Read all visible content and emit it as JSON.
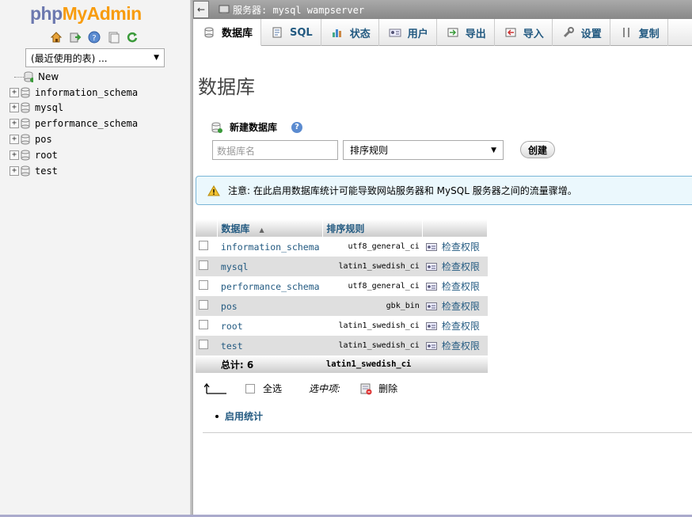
{
  "logo": {
    "php": "php",
    "my": "My",
    "admin": "Admin"
  },
  "nav": {
    "recent_select": "(最近使用的表) ...",
    "tree": [
      {
        "label": "New",
        "expandable": false
      },
      {
        "label": "information_schema",
        "expandable": true
      },
      {
        "label": "mysql",
        "expandable": true
      },
      {
        "label": "performance_schema",
        "expandable": true
      },
      {
        "label": "pos",
        "expandable": true
      },
      {
        "label": "root",
        "expandable": true
      },
      {
        "label": "test",
        "expandable": true
      }
    ],
    "icons": [
      "home-icon",
      "logout-icon",
      "help-icon",
      "docs-icon",
      "reload-icon"
    ]
  },
  "topbar": {
    "back": "←",
    "server": "服务器: mysql wampserver"
  },
  "tabs": [
    {
      "label": "数据库",
      "icon": "database-icon",
      "active": true
    },
    {
      "label": "SQL",
      "icon": "sql-icon",
      "active": false
    },
    {
      "label": "状态",
      "icon": "status-icon",
      "active": false
    },
    {
      "label": "用户",
      "icon": "users-icon",
      "active": false
    },
    {
      "label": "导出",
      "icon": "export-icon",
      "active": false
    },
    {
      "label": "导入",
      "icon": "import-icon",
      "active": false
    },
    {
      "label": "设置",
      "icon": "settings-icon",
      "active": false
    },
    {
      "label": "复制",
      "icon": "replication-icon",
      "active": false
    }
  ],
  "page": {
    "title": "数据库",
    "create_label": "新建数据库",
    "dbname_placeholder": "数据库名",
    "collation_select": "排序规则",
    "create_button": "创建",
    "notice": "注意: 在此启用数据库统计可能导致网站服务器和 MySQL 服务器之间的流量骤增。"
  },
  "table": {
    "headers": {
      "database": "数据库",
      "collation": "排序规则"
    },
    "rows": [
      {
        "name": "information_schema",
        "collation": "utf8_general_ci",
        "action": "检查权限"
      },
      {
        "name": "mysql",
        "collation": "latin1_swedish_ci",
        "action": "检查权限"
      },
      {
        "name": "performance_schema",
        "collation": "utf8_general_ci",
        "action": "检查权限"
      },
      {
        "name": "pos",
        "collation": "gbk_bin",
        "action": "检查权限"
      },
      {
        "name": "root",
        "collation": "latin1_swedish_ci",
        "action": "检查权限"
      },
      {
        "name": "test",
        "collation": "latin1_swedish_ci",
        "action": "检查权限"
      }
    ],
    "total_label": "总计: 6",
    "total_collation": "latin1_swedish_ci"
  },
  "bulk": {
    "select_all": "全选",
    "with_selected": "选中项:",
    "delete": "删除"
  },
  "enable_stats": "启用统计",
  "colors": {
    "link": "#235a81",
    "logo_php": "#6c78af",
    "logo_myadmin": "#f89c0e"
  }
}
